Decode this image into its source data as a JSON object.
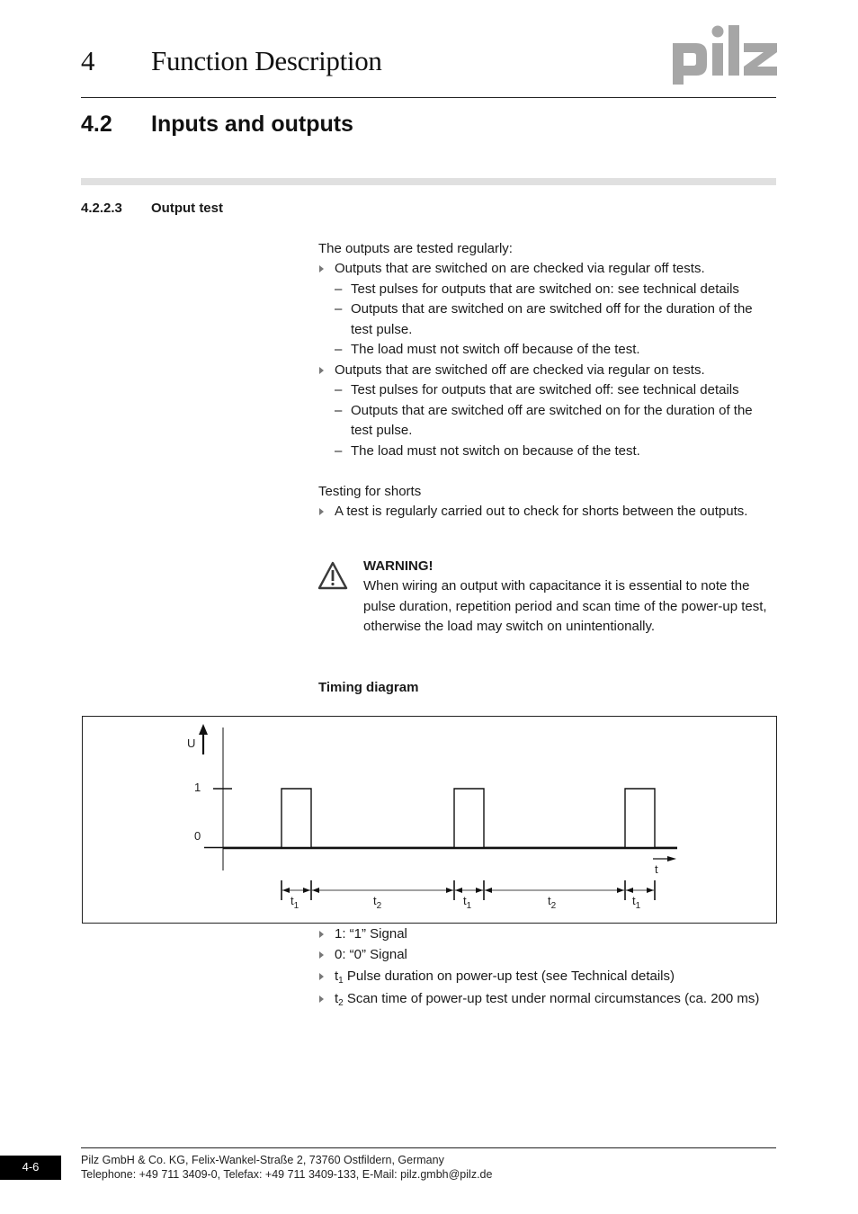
{
  "header": {
    "chapter_number": "4",
    "chapter_title": "Function Description",
    "logo_text": "pilz",
    "logo_color": "#a6a6a6"
  },
  "section": {
    "number": "4.2",
    "title": "Inputs and outputs"
  },
  "subsection": {
    "number": "4.2.2.3",
    "title": "Output test"
  },
  "intro": "The outputs are tested regularly:",
  "bullets": [
    {
      "text": "Outputs that are switched on are checked via regular off tests.",
      "subitems": [
        "Test pulses for outputs that are switched on: see technical details",
        "Outputs that are switched on are switched off for the duration of the test pulse.",
        "The load must not switch off because of the test."
      ]
    },
    {
      "text": "Outputs that are switched off are checked via regular on tests.",
      "subitems": [
        "Test pulses for outputs that are switched off: see technical details",
        "Outputs that are switched off are switched on for the duration of the test pulse.",
        "The load must not switch on because of the test."
      ]
    }
  ],
  "dash_symbol": "–",
  "shorts": {
    "heading": "Testing for shorts",
    "bullet": "A test is regularly carried out to check for shorts between the outputs."
  },
  "warning": {
    "icon": "warning-triangle-icon",
    "title": "WARNING!",
    "text": "When wiring an output with capacitance it is essential to note the pulse duration, repetition period and scan time of the power-up test, otherwise the load may switch on unintentionally."
  },
  "timing_diagram": {
    "title": "Timing diagram",
    "y_axis_label": "U",
    "x_axis_label": "t",
    "level_labels": [
      "1",
      "0"
    ],
    "pulse_count": 3,
    "interval_labels": [
      {
        "base": "t",
        "sub": "1"
      },
      {
        "base": "t",
        "sub": "2"
      },
      {
        "base": "t",
        "sub": "1"
      },
      {
        "base": "t",
        "sub": "2"
      },
      {
        "base": "t",
        "sub": "1"
      }
    ]
  },
  "legend": [
    {
      "prefix": "1: “1” Signal",
      "sub": "",
      "text": ""
    },
    {
      "prefix": "0: “0” Signal",
      "sub": "",
      "text": ""
    },
    {
      "prefix": "t",
      "sub": "1",
      "text": " Pulse duration on power-up test (see Technical details)"
    },
    {
      "prefix": "t",
      "sub": "2",
      "text": " Scan time of power-up test under normal circumstances (ca. 200 ms)"
    }
  ],
  "footer": {
    "page_number": "4-6",
    "line1": "Pilz GmbH & Co. KG, Felix-Wankel-Straße 2, 73760 Ostfildern, Germany",
    "line2": "Telephone: +49 711 3409-0, Telefax: +49 711 3409-133, E-Mail: pilz.gmbh@pilz.de"
  }
}
